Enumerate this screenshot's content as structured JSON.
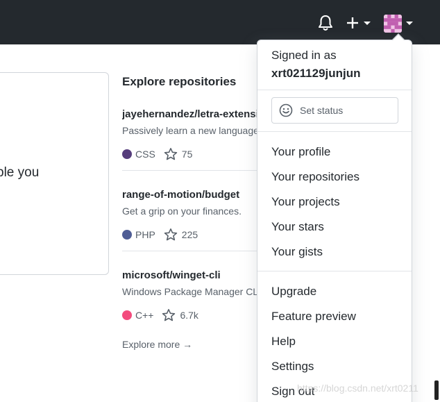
{
  "header": {
    "bell_icon": "bell-icon",
    "plus_icon": "plus-icon",
    "avatar_icon": "identicon-avatar"
  },
  "left_card": {
    "text": "ple you"
  },
  "explore": {
    "title": "Explore repositories",
    "repos": [
      {
        "name": "jayehernandez/letra-extension",
        "description": "Passively learn a new language",
        "language": "CSS",
        "language_color": "#563d7c",
        "stars": "75"
      },
      {
        "name": "range-of-motion/budget",
        "description": "Get a grip on your finances.",
        "language": "PHP",
        "language_color": "#4F5D95",
        "stars": "225"
      },
      {
        "name": "microsoft/winget-cli",
        "description": "Windows Package Manager CLI",
        "language": "C++",
        "language_color": "#f34b7d",
        "stars": "6.7k"
      }
    ],
    "more_label": "Explore more →"
  },
  "dropdown": {
    "signed_in_label": "Signed in as",
    "username": "xrt021129junjun",
    "set_status_label": "Set status",
    "profile_items": [
      "Your profile",
      "Your repositories",
      "Your projects",
      "Your stars",
      "Your gists"
    ],
    "other_items": [
      "Upgrade",
      "Feature preview",
      "Help",
      "Settings",
      "Sign out"
    ]
  },
  "watermark": "https://blog.csdn.net/xrt0211",
  "colors": {
    "header_bg": "#24292e",
    "text": "#24292e",
    "muted": "#586069",
    "border": "#d1d5da",
    "avatar_pink": "#c05fb0"
  }
}
